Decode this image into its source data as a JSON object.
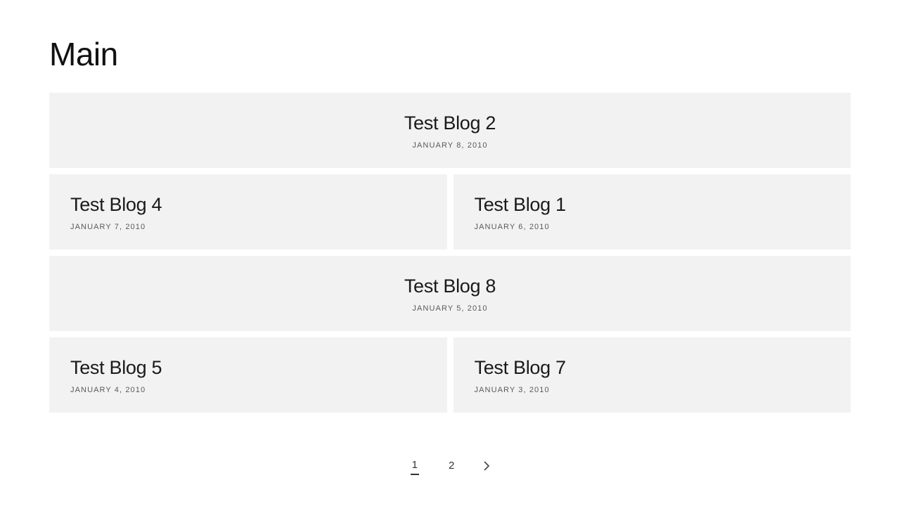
{
  "title": "Main",
  "posts": [
    {
      "layout": "full",
      "title": "Test Blog 2",
      "date": "JANUARY 8, 2010"
    },
    {
      "layout": "half",
      "title": "Test Blog 4",
      "date": "JANUARY 7, 2010"
    },
    {
      "layout": "half",
      "title": "Test Blog 1",
      "date": "JANUARY 6, 2010"
    },
    {
      "layout": "full",
      "title": "Test Blog 8",
      "date": "JANUARY 5, 2010"
    },
    {
      "layout": "half",
      "title": "Test Blog 5",
      "date": "JANUARY 4, 2010"
    },
    {
      "layout": "half",
      "title": "Test Blog 7",
      "date": "JANUARY 3, 2010"
    }
  ],
  "pagination": {
    "pages": [
      "1",
      "2"
    ],
    "current": "1"
  }
}
